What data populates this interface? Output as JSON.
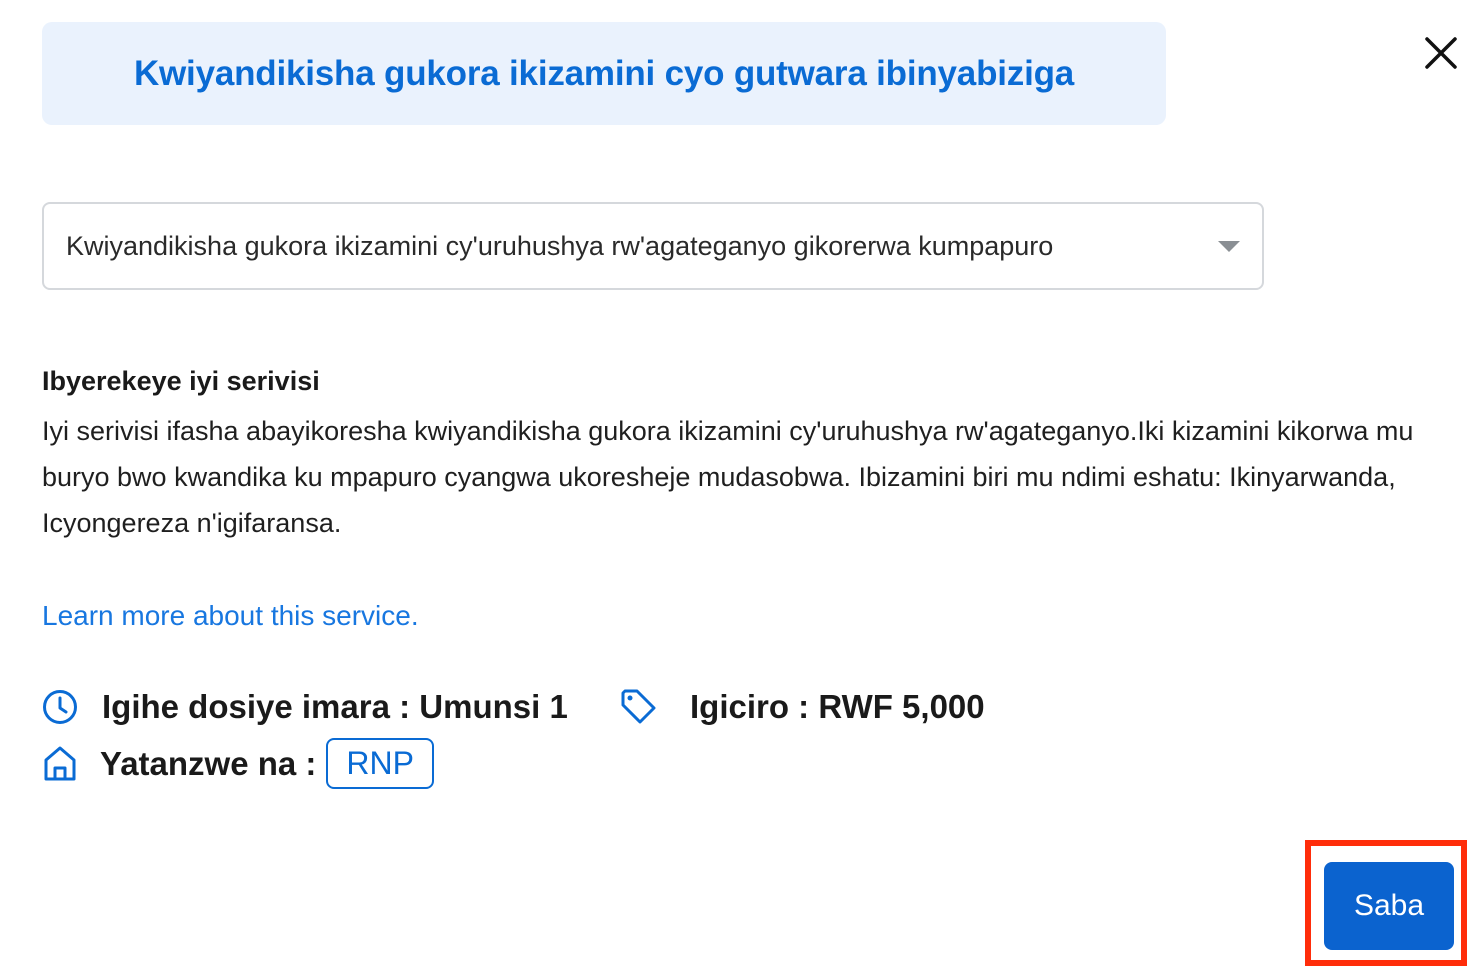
{
  "dialog": {
    "title": "Kwiyandikisha gukora ikizamini cyo gutwara ibinyabiziga",
    "close_icon": "close-icon"
  },
  "service_select": {
    "selected_value": "Kwiyandikisha gukora ikizamini cy'uruhushya rw'agateganyo gikorerwa kumpapuro",
    "caret_icon": "caret-down-icon"
  },
  "about": {
    "heading": "Ibyerekeye iyi serivisi",
    "body": "Iyi serivisi ifasha abayikoresha kwiyandikisha gukora ikizamini cy'uruhushya rw'agateganyo.Iki kizamini kikorwa mu buryo bwo kwandika ku mpapuro cyangwa ukoresheje mudasobwa. Ibizamini biri mu ndimi eshatu: Ikinyarwanda, Icyongereza n'igifaransa."
  },
  "learn_more": {
    "label": "Learn more about this service."
  },
  "meta": {
    "processing_time": "Igihe dosiye imara : Umunsi 1",
    "price": "Igiciro : RWF 5,000",
    "provider_label": "Yatanzwe na :",
    "provider_badge": "RNP",
    "icons": [
      "clock-icon",
      "tag-icon",
      "home-icon"
    ]
  },
  "actions": {
    "next_label": "Saba"
  },
  "colors": {
    "accent": "#0a6bd4",
    "banner_bg": "#eaf2fd",
    "button_bg": "#0b63cf",
    "highlight": "#ff2d0a",
    "link": "#1877e0"
  }
}
